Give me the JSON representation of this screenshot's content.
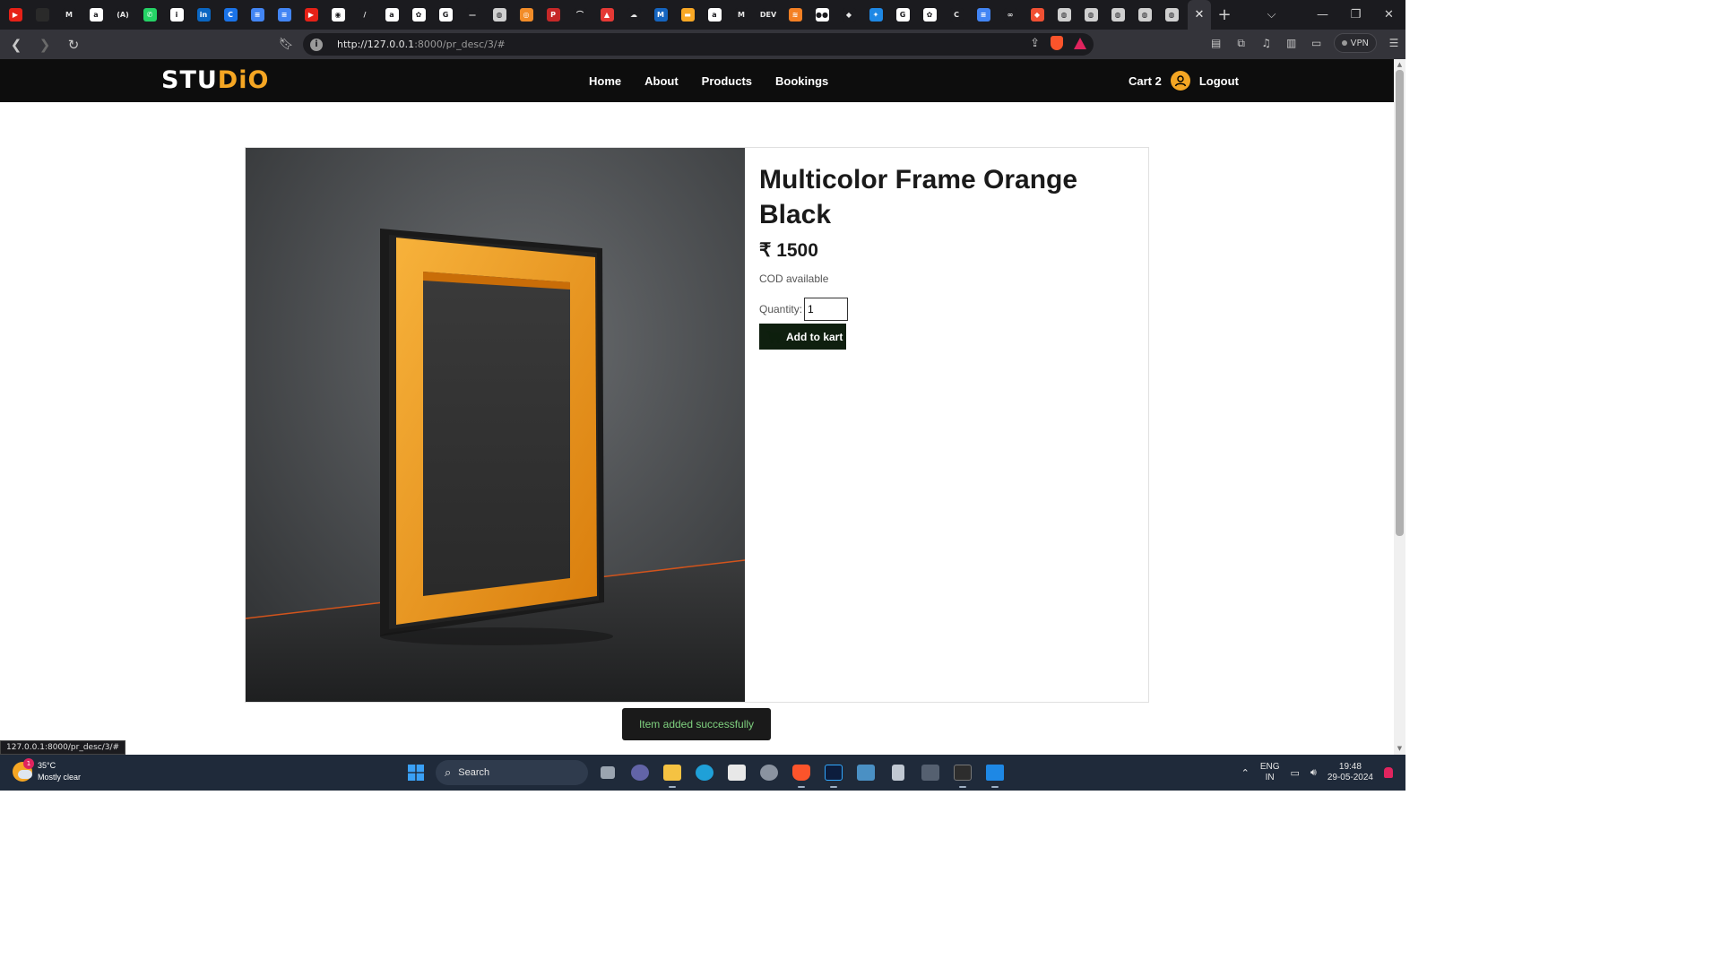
{
  "browser": {
    "tab_favicons": [
      {
        "name": "youtube-tab-icon",
        "color": "#e62117",
        "glyph": "▶"
      },
      {
        "name": "dark-tab-icon",
        "color": "#2a2a2a",
        "glyph": ""
      },
      {
        "name": "gmail-tab-icon",
        "color": "#1b1b1f",
        "glyph": "M"
      },
      {
        "name": "amazon-tab-icon",
        "color": "#ffffff",
        "glyph": "a"
      },
      {
        "name": "bracket-tab-icon",
        "color": "#1b1b1f",
        "glyph": "(A)"
      },
      {
        "name": "whatsapp-tab-icon",
        "color": "#25d366",
        "glyph": "✆"
      },
      {
        "name": "info-tab-icon",
        "color": "#ffffff",
        "glyph": "i"
      },
      {
        "name": "linkedin-tab-icon",
        "color": "#0a66c2",
        "glyph": "in"
      },
      {
        "name": "blue-circle-tab-icon",
        "color": "#1a73e8",
        "glyph": "C"
      },
      {
        "name": "docs-tab-icon",
        "color": "#4285f4",
        "glyph": "≡"
      },
      {
        "name": "docs-tab-icon-2",
        "color": "#4285f4",
        "glyph": "≡"
      },
      {
        "name": "youtube-tab-icon-2",
        "color": "#e62117",
        "glyph": "▶"
      },
      {
        "name": "github-tab-icon",
        "color": "#ffffff",
        "glyph": "◉"
      },
      {
        "name": "slash-tab-icon",
        "color": "#1b1b1f",
        "glyph": "/"
      },
      {
        "name": "amazon-tab-icon-2",
        "color": "#ffffff",
        "glyph": "a"
      },
      {
        "name": "openai-tab-icon",
        "color": "#ffffff",
        "glyph": "✿"
      },
      {
        "name": "google-tab-icon",
        "color": "#ffffff",
        "glyph": "G"
      },
      {
        "name": "dash-tab-icon",
        "color": "#1b1b1f",
        "glyph": "—"
      },
      {
        "name": "globe-tab-icon",
        "color": "#d0d0d0",
        "glyph": "◍"
      },
      {
        "name": "orange-tab-icon",
        "color": "#f28c28",
        "glyph": "◎"
      },
      {
        "name": "pdf-tab-icon",
        "color": "#c62828",
        "glyph": "P"
      },
      {
        "name": "arc-tab-icon",
        "color": "#1b1b1f",
        "glyph": "⌒"
      },
      {
        "name": "flame-tab-icon",
        "color": "#e53935",
        "glyph": "▲"
      },
      {
        "name": "cloud-tab-icon",
        "color": "#1b1b1f",
        "glyph": "☁"
      },
      {
        "name": "chart-tab-icon",
        "color": "#1565c0",
        "glyph": "M"
      },
      {
        "name": "card-tab-icon",
        "color": "#f9a825",
        "glyph": "▬"
      },
      {
        "name": "amazon-tab-icon-3",
        "color": "#ffffff",
        "glyph": "a"
      },
      {
        "name": "medium-tab-icon",
        "color": "#1b1b1f",
        "glyph": "M"
      },
      {
        "name": "dev-tab-icon",
        "color": "#1b1b1f",
        "glyph": "DEV"
      },
      {
        "name": "stack-tab-icon",
        "color": "#f48024",
        "glyph": "≋"
      },
      {
        "name": "flickr-tab-icon",
        "color": "#ffffff",
        "glyph": "●●"
      },
      {
        "name": "code-tab-icon",
        "color": "#1b1b1f",
        "glyph": "◆"
      },
      {
        "name": "colorful-tab-icon",
        "color": "#1e88e5",
        "glyph": "✦"
      },
      {
        "name": "google-tab-icon-2",
        "color": "#ffffff",
        "glyph": "G"
      },
      {
        "name": "openai-tab-icon-2",
        "color": "#ffffff",
        "glyph": "✿"
      },
      {
        "name": "red-c-tab-icon",
        "color": "#1b1b1f",
        "glyph": "C"
      },
      {
        "name": "docs-tab-icon-3",
        "color": "#4285f4",
        "glyph": "≡"
      },
      {
        "name": "infinity-tab-icon",
        "color": "#1b1b1f",
        "glyph": "∞"
      },
      {
        "name": "git-tab-icon",
        "color": "#f05033",
        "glyph": "◆"
      },
      {
        "name": "globe-tab-icon-2",
        "color": "#d0d0d0",
        "glyph": "◍"
      },
      {
        "name": "globe-tab-icon-3",
        "color": "#d0d0d0",
        "glyph": "◍"
      },
      {
        "name": "globe-tab-icon-4",
        "color": "#d0d0d0",
        "glyph": "◍"
      },
      {
        "name": "globe-tab-icon-5",
        "color": "#d0d0d0",
        "glyph": "◍"
      },
      {
        "name": "globe-tab-icon-6",
        "color": "#d0d0d0",
        "glyph": "◍"
      }
    ],
    "active_tab_close": "✕",
    "new_tab": "+",
    "url_host": "http://127.0.0.1",
    "url_rest": ":8000/pr_desc/3/#",
    "vpn_label": "VPN",
    "status_url": "127.0.0.1:8000/pr_desc/3/#"
  },
  "site": {
    "logo_prefix": "STU",
    "logo_accent": "DiO",
    "nav": [
      "Home",
      "About",
      "Products",
      "Bookings"
    ],
    "cart_label": "Cart 2",
    "logout_label": "Logout",
    "accent_color": "#f5a623"
  },
  "product": {
    "title": "Multicolor Frame Orange Black",
    "price": "₹ 1500",
    "cod": "COD available",
    "quantity_label": "Quantity:",
    "quantity_value": "1",
    "add_button": "Add to kart"
  },
  "toast": {
    "message": "Item added successfully"
  },
  "taskbar": {
    "weather_temp": "35°C",
    "weather_desc": "Mostly clear",
    "weather_badge": "1",
    "search_label": "Search",
    "lang_top": "ENG",
    "lang_bottom": "IN",
    "time": "19:48",
    "date": "29-05-2024"
  }
}
